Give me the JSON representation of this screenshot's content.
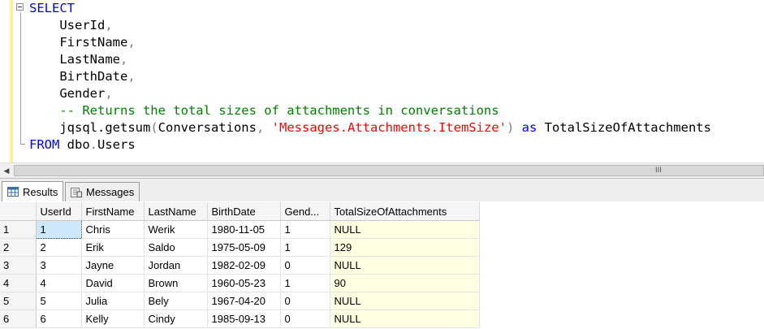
{
  "editor": {
    "lines": [
      [
        {
          "t": "SELECT",
          "c": "kw"
        }
      ],
      [
        {
          "t": "    UserId",
          "c": ""
        },
        {
          "t": ",",
          "c": "gray"
        }
      ],
      [
        {
          "t": "    FirstName",
          "c": ""
        },
        {
          "t": ",",
          "c": "gray"
        }
      ],
      [
        {
          "t": "    LastName",
          "c": ""
        },
        {
          "t": ",",
          "c": "gray"
        }
      ],
      [
        {
          "t": "    BirthDate",
          "c": ""
        },
        {
          "t": ",",
          "c": "gray"
        }
      ],
      [
        {
          "t": "    Gender",
          "c": ""
        },
        {
          "t": ",",
          "c": "gray"
        }
      ],
      [
        {
          "t": "    -- Returns the total sizes of attachments in conversations",
          "c": "cmt"
        }
      ],
      [
        {
          "t": "    jqsql.getsum",
          "c": ""
        },
        {
          "t": "(",
          "c": "gray"
        },
        {
          "t": "Conversations",
          "c": ""
        },
        {
          "t": ", ",
          "c": "gray"
        },
        {
          "t": "'Messages.Attachments.ItemSize'",
          "c": "str"
        },
        {
          "t": ")",
          "c": "gray"
        },
        {
          "t": " ",
          "c": ""
        },
        {
          "t": "as",
          "c": "kw"
        },
        {
          "t": " TotalSizeOfAttachments",
          "c": ""
        }
      ],
      [
        {
          "t": "FROM",
          "c": "kw"
        },
        {
          "t": " dbo",
          "c": ""
        },
        {
          "t": ".",
          "c": "gray"
        },
        {
          "t": "Users",
          "c": ""
        }
      ]
    ]
  },
  "scrollbar": {
    "grip": "III",
    "left_arrow": "◀"
  },
  "tabs": {
    "results": "Results",
    "messages": "Messages"
  },
  "grid": {
    "columns": [
      "UserId",
      "FirstName",
      "LastName",
      "BirthDate",
      "Gend...",
      "TotalSizeOfAttachments"
    ],
    "rows": [
      {
        "n": "1",
        "cells": [
          "1",
          "Chris",
          "Werik",
          "1980-11-05",
          "1",
          "NULL"
        ]
      },
      {
        "n": "2",
        "cells": [
          "2",
          "Erik",
          "Saldo",
          "1975-05-09",
          "1",
          "129"
        ]
      },
      {
        "n": "3",
        "cells": [
          "3",
          "Jayne",
          "Jordan",
          "1982-02-09",
          "0",
          "NULL"
        ]
      },
      {
        "n": "4",
        "cells": [
          "4",
          "David",
          "Brown",
          "1960-05-23",
          "1",
          "90"
        ]
      },
      {
        "n": "5",
        "cells": [
          "5",
          "Julia",
          "Bely",
          "1967-04-20",
          "0",
          "NULL"
        ]
      },
      {
        "n": "6",
        "cells": [
          "6",
          "Kelly",
          "Cindy",
          "1985-09-13",
          "0",
          "NULL"
        ]
      }
    ]
  }
}
